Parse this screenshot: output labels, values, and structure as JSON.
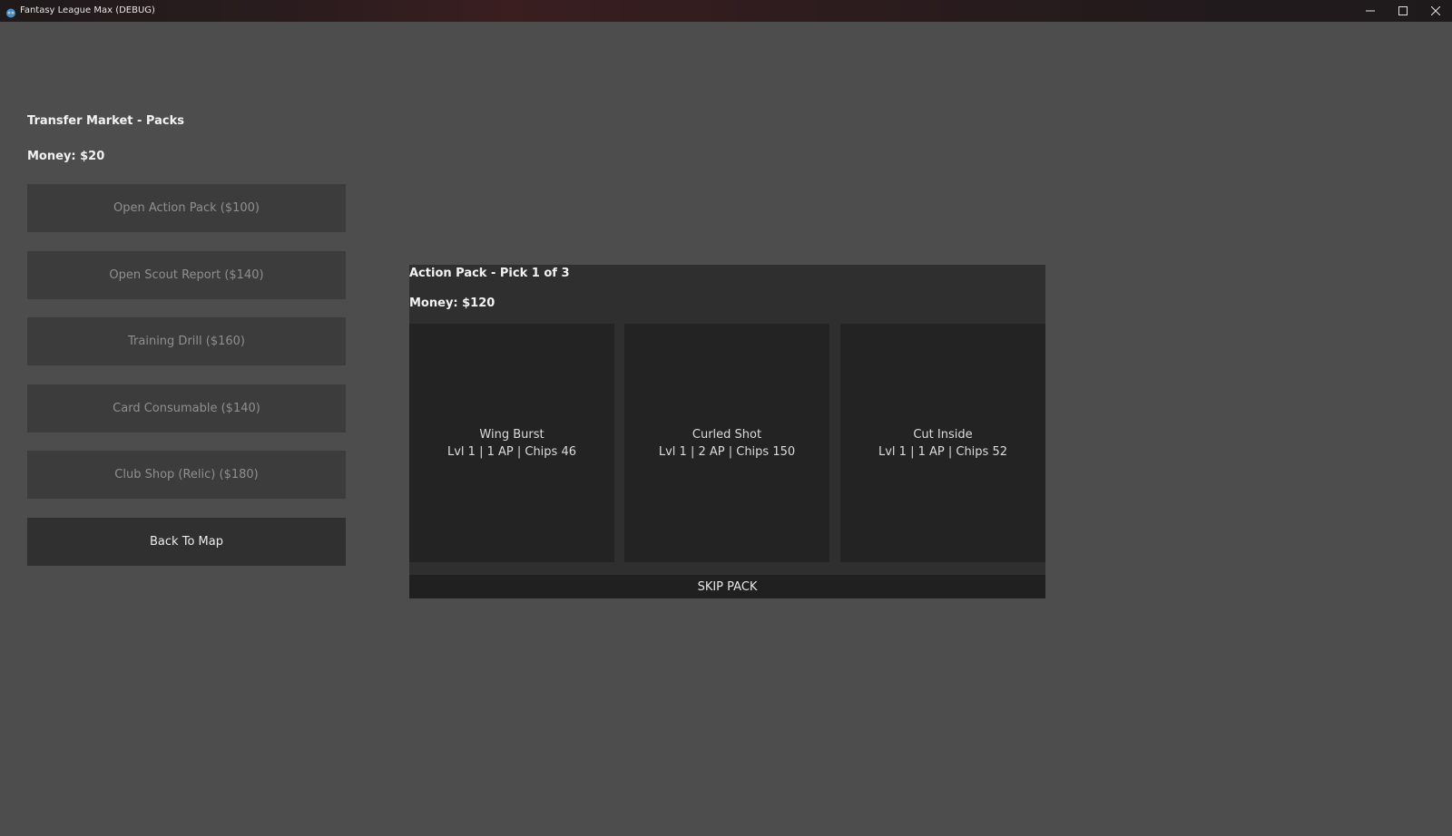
{
  "window": {
    "title": "Fantasy League Max (DEBUG)",
    "icon": "godot-icon",
    "controls": [
      "minimize-icon",
      "maximize-icon",
      "close-icon"
    ]
  },
  "market": {
    "title": "Transfer Market - Packs",
    "money": "Money: $20",
    "buttons": [
      {
        "label": "Open Action Pack ($100)",
        "enabled": false
      },
      {
        "label": "Open Scout Report ($140)",
        "enabled": false
      },
      {
        "label": "Training Drill ($160)",
        "enabled": false
      },
      {
        "label": "Card Consumable ($140)",
        "enabled": false
      },
      {
        "label": "Club Shop (Relic) ($180)",
        "enabled": false
      },
      {
        "label": "Back To Map",
        "enabled": true
      }
    ]
  },
  "pack": {
    "title": "Action Pack - Pick 1 of 3",
    "money": "Money: $120",
    "cards": [
      {
        "name": "Wing Burst",
        "stats": "Lvl 1 | 1 AP | Chips 46"
      },
      {
        "name": "Curled Shot",
        "stats": "Lvl 1 | 2 AP | Chips 150"
      },
      {
        "name": "Cut Inside",
        "stats": "Lvl 1 | 1 AP | Chips 52"
      }
    ],
    "skip_label": "SKIP PACK"
  },
  "colors": {
    "background": "#4d4d4d",
    "button_disabled": "#3c3c3c",
    "button_enabled": "#303030",
    "panel": "#2f2f2f",
    "card": "#232323",
    "icon_accent": "#478cbf"
  }
}
